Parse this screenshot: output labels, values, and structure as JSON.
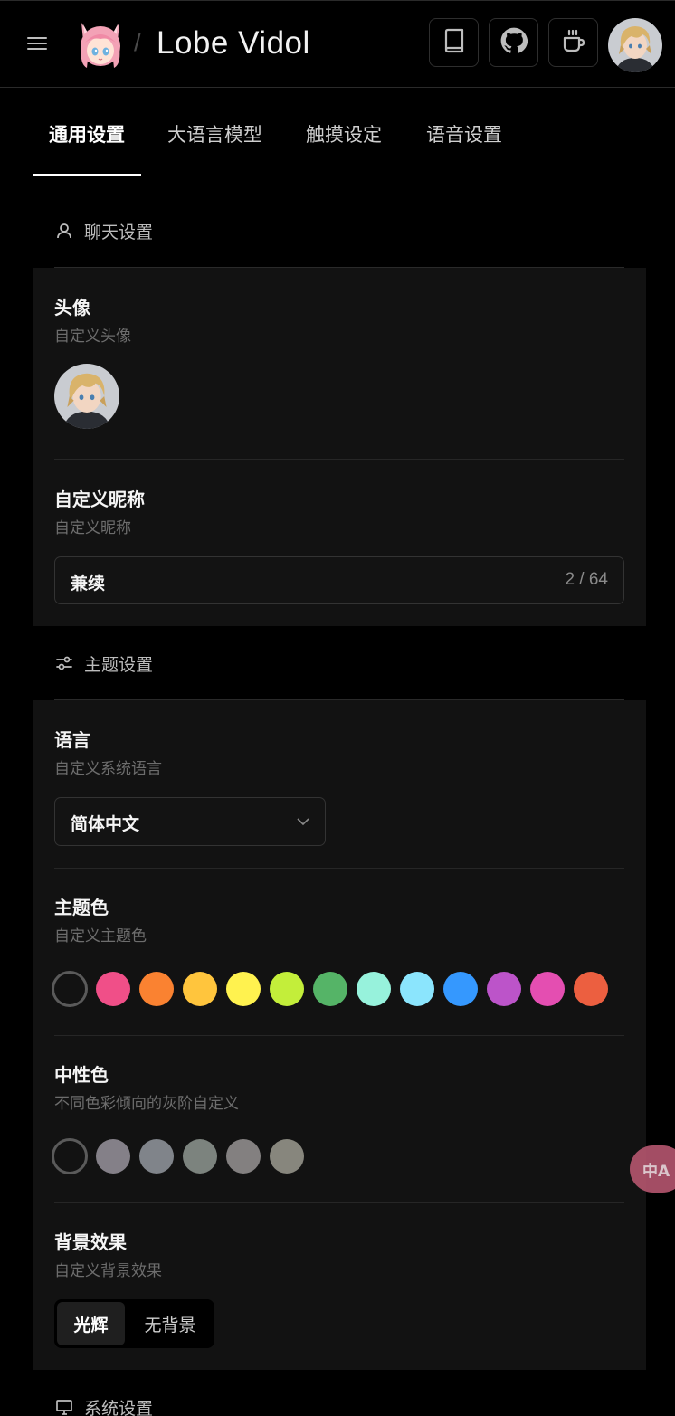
{
  "header": {
    "app_title": "Lobe Vidol",
    "separator": "/",
    "buttons": [
      "book-icon",
      "github-icon",
      "coffee-icon"
    ]
  },
  "tabs": [
    {
      "label": "通用设置",
      "active": true
    },
    {
      "label": "大语言模型",
      "active": false
    },
    {
      "label": "触摸设定",
      "active": false
    },
    {
      "label": "语音设置",
      "active": false
    }
  ],
  "chat_settings": {
    "section_title": "聊天设置",
    "avatar": {
      "title": "头像",
      "desc": "自定义头像"
    },
    "nickname": {
      "title": "自定义昵称",
      "desc": "自定义昵称",
      "value": "兼续",
      "count": "2 / 64"
    }
  },
  "theme_settings": {
    "section_title": "主题设置",
    "language": {
      "title": "语言",
      "desc": "自定义系统语言",
      "value": "简体中文"
    },
    "primary_color": {
      "title": "主题色",
      "desc": "自定义主题色",
      "colors": [
        "#f04f88",
        "#fa8231",
        "#ffc53d",
        "#fff24f",
        "#c3ee3a",
        "#55b467",
        "#97f2dc",
        "#8be5fd",
        "#3598fe",
        "#bc54c9",
        "#e44eb1",
        "#ec5f40"
      ]
    },
    "neutral_color": {
      "title": "中性色",
      "desc": "不同色彩倾向的灰阶自定义",
      "colors": [
        "#848088",
        "#80848a",
        "#7c837e",
        "#838080",
        "#87867d"
      ]
    },
    "background_effect": {
      "title": "背景效果",
      "desc": "自定义背景效果",
      "options": [
        "光辉",
        "无背景"
      ],
      "selected": "光辉"
    }
  },
  "system_settings": {
    "section_title": "系统设置"
  },
  "translate_fab": {
    "label": "中A"
  }
}
